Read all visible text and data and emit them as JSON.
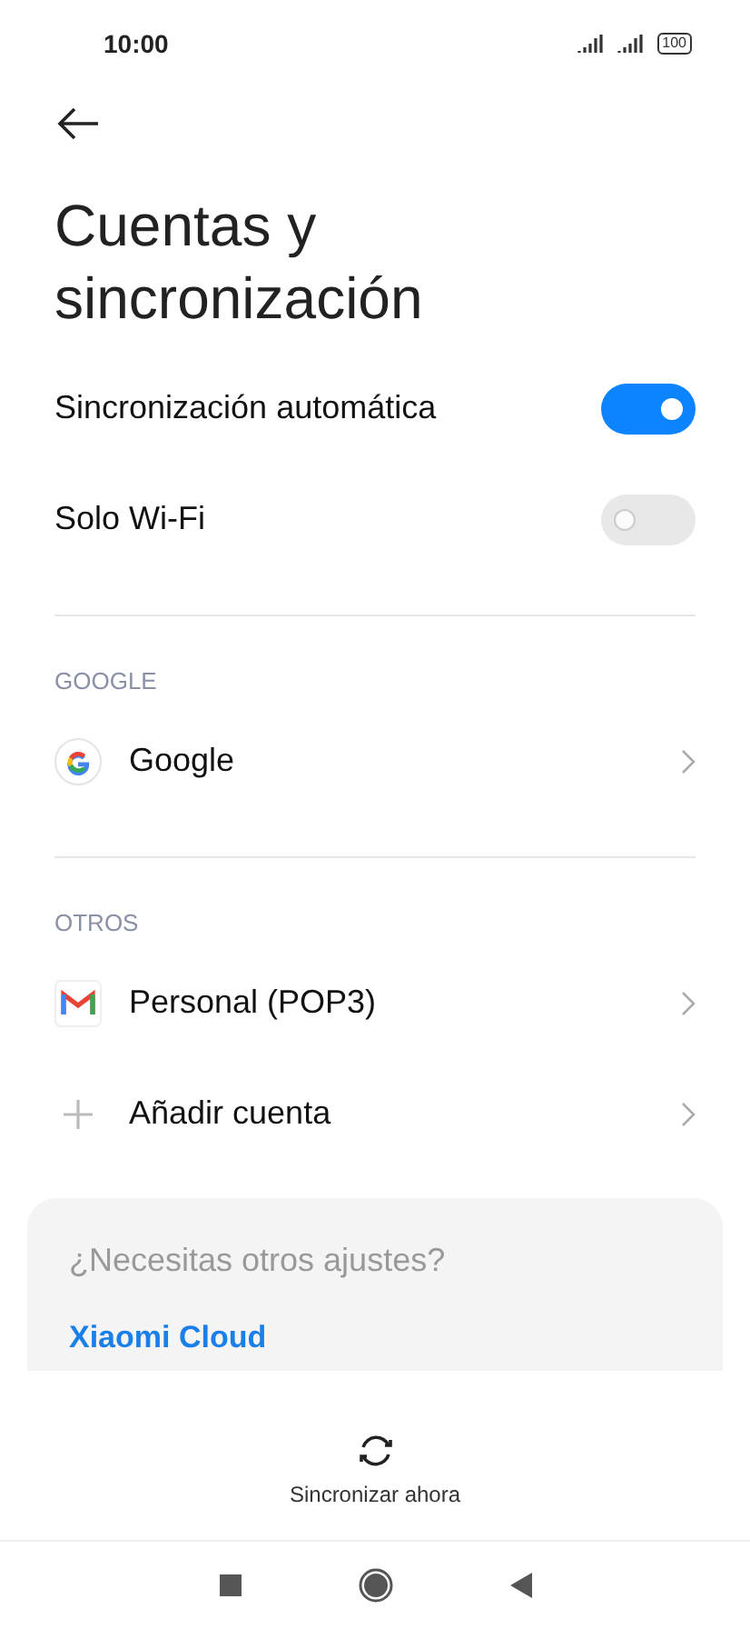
{
  "status_bar": {
    "time": "10:00",
    "battery": "100"
  },
  "title": "Cuentas y sincronización",
  "toggles": [
    {
      "label": "Sincronización automática",
      "on": true
    },
    {
      "label": "Solo Wi-Fi",
      "on": false
    }
  ],
  "sections": [
    {
      "header": "GOOGLE",
      "items": [
        {
          "kind": "google",
          "label": "Google"
        }
      ]
    },
    {
      "header": "OTROS",
      "items": [
        {
          "kind": "gmail",
          "label": "Personal (POP3)"
        },
        {
          "kind": "add",
          "label": "Añadir cuenta"
        }
      ]
    }
  ],
  "card": {
    "question": "¿Necesitas otros ajustes?",
    "link": "Xiaomi Cloud"
  },
  "sync_button": "Sincronizar ahora"
}
